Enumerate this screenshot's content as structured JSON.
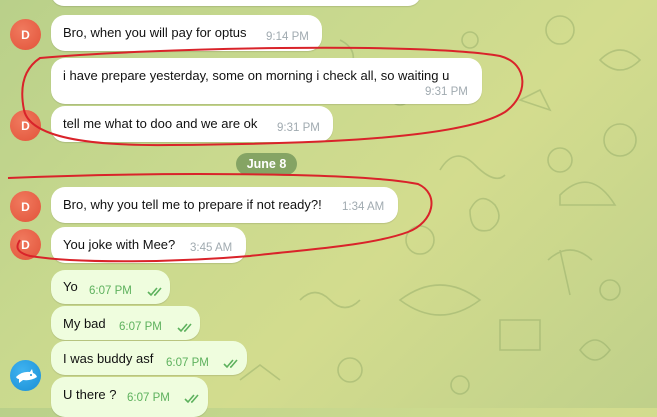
{
  "date_separator": "June 8",
  "avatar_letter": "D",
  "messages": [
    {
      "text": "Bro, when you will pay for optus",
      "time": "9:14 PM"
    },
    {
      "text": "i have prepare yesterday, some on morning i check all, so waiting u",
      "time": "9:31 PM"
    },
    {
      "text": "tell me what to doo and we are ok",
      "time": "9:31 PM"
    },
    {
      "text": "Bro, why you tell me to prepare if not ready?!",
      "time": "1:34 AM"
    },
    {
      "text": "You joke with Mee?",
      "time": "3:45 AM"
    }
  ],
  "outgoing": [
    {
      "text": "Yo",
      "time": "6:07 PM"
    },
    {
      "text": "My bad",
      "time": "6:07 PM"
    },
    {
      "text": "I was buddy asf",
      "time": "6:07 PM"
    },
    {
      "text": "U there ?",
      "time": "6:07 PM"
    }
  ],
  "colors": {
    "incoming_bubble": "#ffffff",
    "outgoing_bubble": "#effdde",
    "avatar_red": "#e2533a",
    "avatar_blue": "#1a8fd6",
    "read_check": "#5db15d",
    "annotation_red": "#d9232a"
  },
  "icons": {
    "outgoing_avatar": "shark-icon",
    "read_receipt": "double-check-icon"
  }
}
